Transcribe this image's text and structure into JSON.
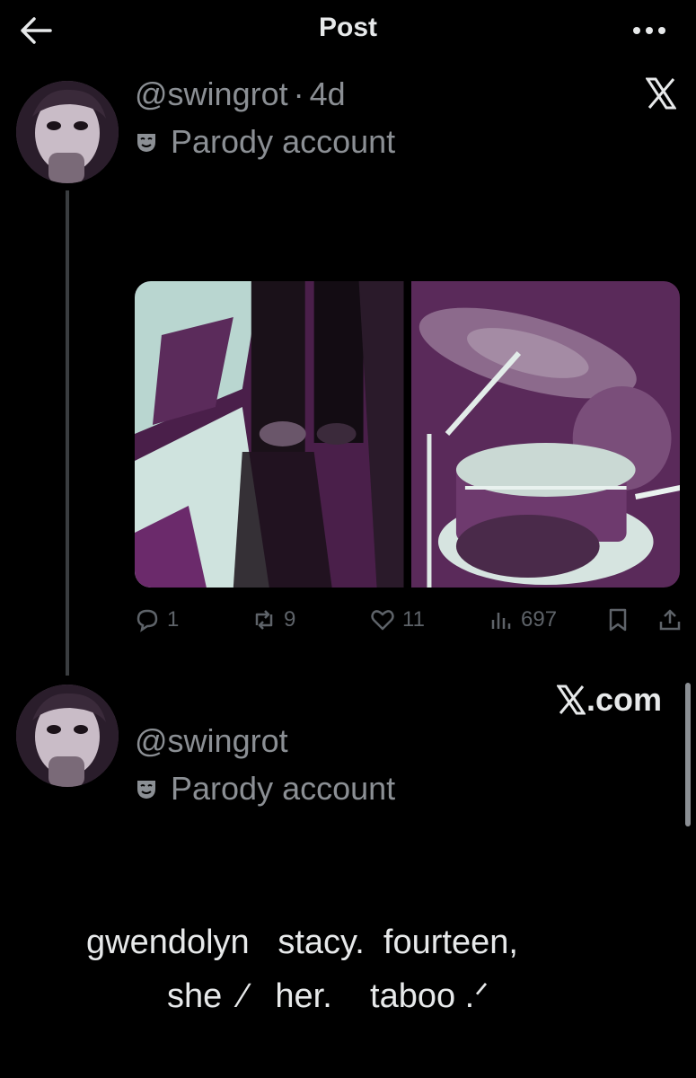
{
  "header": {
    "title": "Post"
  },
  "post": {
    "handle": "@swingrot",
    "separator": "·",
    "age": "4d",
    "label": "Parody account",
    "stats": {
      "replies": "1",
      "reposts": "9",
      "likes": "11",
      "views": "697"
    }
  },
  "profile_card": {
    "handle": "@swingrot",
    "label": "Parody account",
    "site": ".com"
  },
  "bio": {
    "line1": "gwendolyn   stacy.  fourteen,",
    "line2": "she  ⁄   her.    taboo .ᐟ"
  },
  "colors": {
    "background": "#000000",
    "muted_text": "#8b8f94",
    "icon_gray": "#5e6369",
    "photo_tint": "#6b2a6b"
  }
}
